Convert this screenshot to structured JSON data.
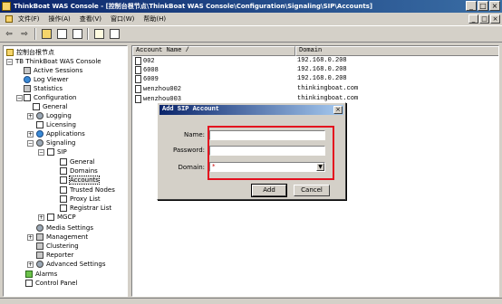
{
  "window": {
    "title": "ThinkBoat WAS Console - [控制台根节点\\ThinkBoat WAS Console\\Configuration\\Signaling\\SIP\\Accounts]",
    "min_label": "_",
    "max_label": "□",
    "close_label": "×"
  },
  "menu": {
    "file": "文件(F)",
    "action": "操作(A)",
    "view": "查看(V)",
    "window": "窗口(W)",
    "help": "帮助(H)"
  },
  "toolbar": {
    "back": "⇦",
    "forward": "⇨"
  },
  "tree": {
    "root": "控制台根节点",
    "console": "TB ThinkBoat WAS Console",
    "active_sessions": "Active Sessions",
    "log_viewer": "Log Viewer",
    "statistics": "Statistics",
    "configuration": "Configuration",
    "general": "General",
    "logging": "Logging",
    "licensing": "Licensing",
    "applications": "Applications",
    "signaling": "Signaling",
    "sip": "SIP",
    "sip_general": "General",
    "domains": "Domains",
    "accounts": "Accounts",
    "trusted_nodes": "Trusted Nodes",
    "proxy_list": "Proxy List",
    "registrar_list": "Registrar List",
    "mgcp": "MGCP",
    "media_settings": "Media Settings",
    "management": "Management",
    "clustering": "Clustering",
    "reporter": "Reporter",
    "advanced_settings": "Advanced Settings",
    "alarms": "Alarms",
    "control_panel": "Control Panel"
  },
  "list": {
    "col_account": "Account Name  /",
    "col_domain": "Domain",
    "rows": [
      {
        "account": "002",
        "domain": "192.168.0.208"
      },
      {
        "account": "6008",
        "domain": "192.168.0.208"
      },
      {
        "account": "6009",
        "domain": "192.168.0.208"
      },
      {
        "account": "wenzhou002",
        "domain": "thinkingboat.com"
      },
      {
        "account": "wenzhou003",
        "domain": "thinkingboat.com"
      }
    ]
  },
  "dialog": {
    "title": "Add SIP Account",
    "close_label": "×",
    "name_label": "Name:",
    "name_value": "",
    "password_label": "Password:",
    "password_value": "",
    "domain_label": "Domain:",
    "domain_value": "*",
    "add_label": "Add",
    "cancel_label": "Cancel"
  },
  "colors": {
    "highlight": "#e4101e",
    "titlebar": "#0a246a"
  }
}
